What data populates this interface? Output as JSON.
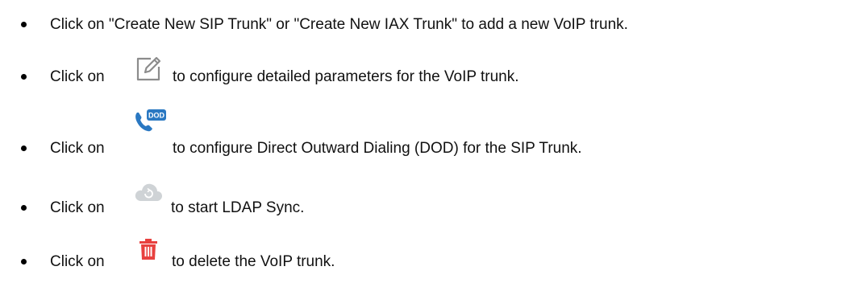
{
  "items": [
    {
      "text": "Click on \"Create New SIP Trunk\" or \"Create New IAX Trunk\" to add a new VoIP trunk."
    },
    {
      "prefix": "Click on",
      "icon": "edit-icon",
      "suffix": "to configure detailed parameters for the VoIP trunk."
    },
    {
      "prefix": "Click on",
      "icon": "dod-phone-icon",
      "icon_text": "DOD",
      "suffix": "to configure Direct Outward Dialing (DOD) for the SIP Trunk."
    },
    {
      "prefix": "Click on",
      "icon": "cloud-sync-icon",
      "suffix": "to start LDAP Sync."
    },
    {
      "prefix": "Click on",
      "icon": "trash-icon",
      "suffix": "to delete the VoIP trunk."
    }
  ],
  "colors": {
    "text": "#111111",
    "icon_gray": "#8c8c8c",
    "icon_light_gray": "#cfd3d6",
    "icon_red": "#e8413f",
    "icon_blue": "#2a78c2"
  }
}
